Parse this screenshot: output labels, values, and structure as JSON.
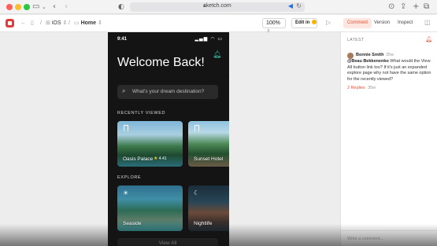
{
  "browser": {
    "url": "sketch.com"
  },
  "toolbar": {
    "separator": "/",
    "project": "iOS",
    "page": "Home",
    "zoom": "100%",
    "edit_label": "Edit in"
  },
  "panel": {
    "tabs": [
      "Comment",
      "Version",
      "Inspect"
    ],
    "active_tab": "Comment",
    "latest_label": "LATEST",
    "comment": {
      "author": "Bonnie Smith",
      "time": "35w",
      "mention": "@Beau Bekkenenko",
      "text": " What would the View All button link too? If it's just an expanded explore page why not have the same option for the recently viewed?",
      "replies": "2 Replies",
      "replies_time": "35w"
    },
    "write_placeholder": "Write a comment..."
  },
  "phone": {
    "time": "9:41",
    "status_icons": "▂▄▆ ◠ ▭",
    "title": "Welcome Back!",
    "search_placeholder": "What's your dream destination?",
    "recently_viewed_label": "RECENTLY VIEWED",
    "recent_cards": [
      {
        "name": "Oasis Palace",
        "rating": "4.41"
      },
      {
        "name": "Sunset Hotel",
        "rating": ""
      }
    ],
    "explore_label": "EXPLORE",
    "explore_cards": [
      {
        "name": "Seaside",
        "icon": "sun-icon"
      },
      {
        "name": "Nightlife",
        "icon": "moon-icon"
      }
    ],
    "view_all": "View All"
  },
  "colors": {
    "accent": "#e2543a",
    "bell": "#3ec9b3",
    "phone_bg": "#141414"
  }
}
